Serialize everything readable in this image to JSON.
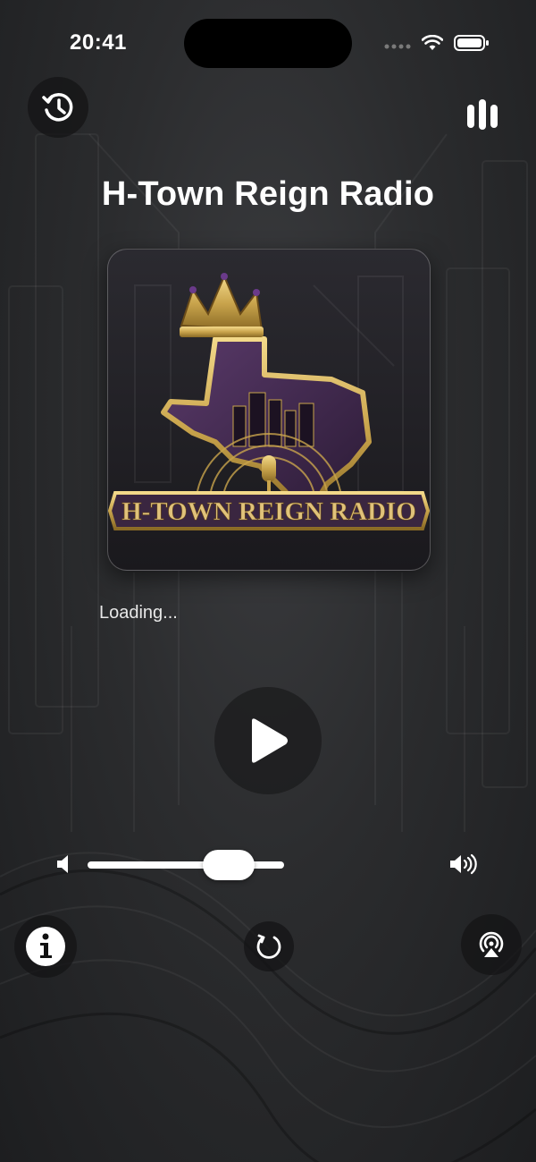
{
  "status": {
    "time": "20:41"
  },
  "station": {
    "title": "H-Town Reign Radio",
    "logo_text": "H-TOWN REIGN RADIO"
  },
  "player": {
    "status_text": "Loading...",
    "volume_level": 0.77
  },
  "icons": {
    "history": "history-icon",
    "menu": "bars-icon",
    "play": "play-icon",
    "volume_low": "speaker-low-icon",
    "volume_high": "speaker-high-icon",
    "info": "info-icon",
    "refresh": "refresh-icon",
    "airplay": "airplay-icon"
  },
  "colors": {
    "gold": "#c9a44c",
    "purple": "#4a2a5a",
    "background": "#2a2b2d"
  }
}
